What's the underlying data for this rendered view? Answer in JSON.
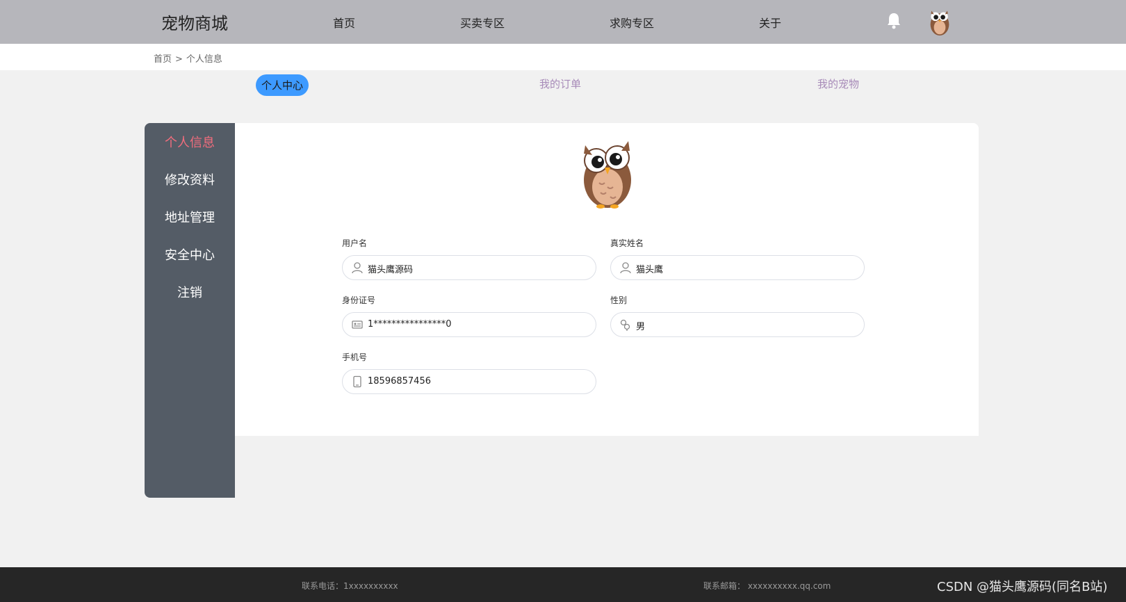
{
  "header": {
    "logo": "宠物商城",
    "nav": [
      "首页",
      "买卖专区",
      "求购专区",
      "关于"
    ]
  },
  "breadcrumb": {
    "home": "首页",
    "sep": ">",
    "current": "个人信息"
  },
  "tabs": [
    "个人中心",
    "我的订单",
    "我的宠物"
  ],
  "side_menu": [
    "个人信息",
    "修改资料",
    "地址管理",
    "安全中心",
    "注销"
  ],
  "profile": {
    "username_label": "用户名",
    "username": "猫头鹰源码",
    "realname_label": "真实姓名",
    "realname": "猫头鹰",
    "idcard_label": "身份证号",
    "idcard": "1****************0",
    "gender_label": "性别",
    "gender": "男",
    "phone_label": "手机号",
    "phone": "18596857456"
  },
  "footer": {
    "phone": "联系电话：1xxxxxxxxxx",
    "email": "联系邮箱：  xxxxxxxxxx.qq.com",
    "watermark": "CSDN @猫头鹰源码(同名B站)"
  },
  "colors": {
    "header_bg": "#b6b6bb",
    "tab_active_bg": "#3d9aff",
    "tab_text": "#a78ab8",
    "side_bg": "#545c66",
    "side_active": "#f26d7d",
    "footer_bg": "#262626"
  },
  "icons": [
    "bell-icon",
    "avatar",
    "owl-avatar",
    "user-icon",
    "id-card-icon",
    "gender-icon",
    "phone-icon"
  ]
}
